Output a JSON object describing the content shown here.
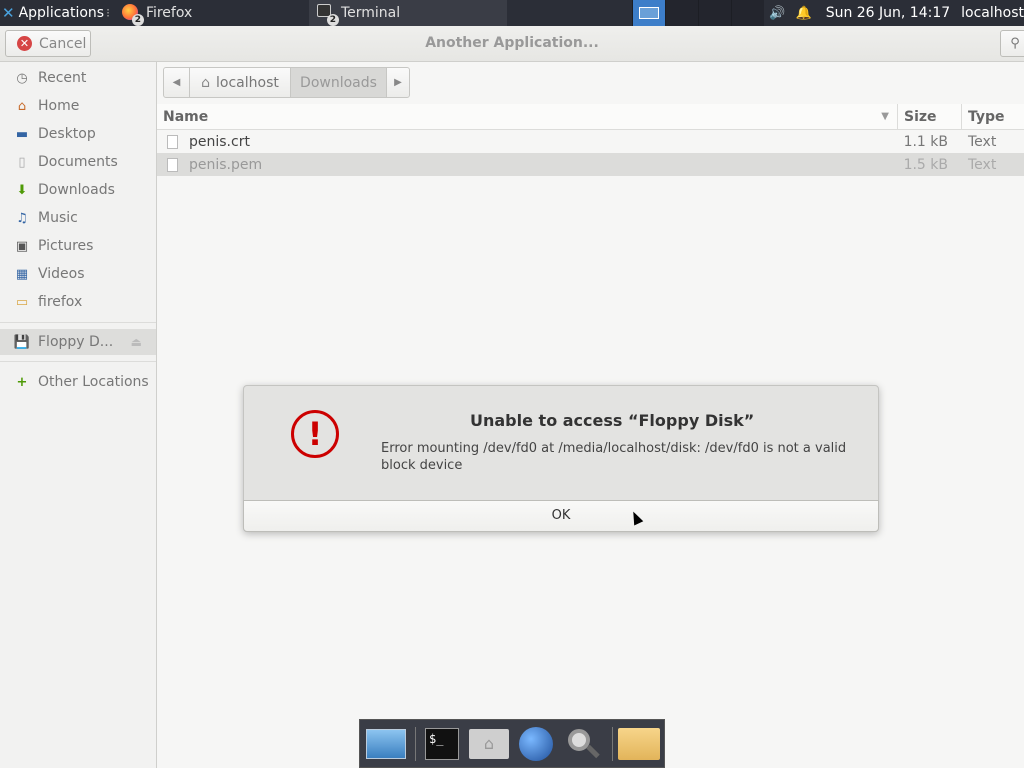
{
  "top_panel": {
    "applications_label": "Applications",
    "apps_more": "⁝",
    "tasks": [
      {
        "label": "Firefox",
        "badge": "2"
      },
      {
        "label": "Terminal",
        "badge": "2"
      }
    ],
    "volume_icon": "🔊",
    "bell_icon": "🔔",
    "clock": "Sun 26 Jun, 14:17",
    "user": "localhost"
  },
  "headerbar": {
    "cancel_label": "Cancel",
    "cancel_icon": "✕",
    "title": "Another Application...",
    "search_icon": "⚲"
  },
  "sidebar": {
    "places": [
      {
        "label": "Recent",
        "icon": "◷"
      },
      {
        "label": "Home",
        "icon": "⌂"
      },
      {
        "label": "Desktop",
        "icon": "▬"
      },
      {
        "label": "Documents",
        "icon": "▯"
      },
      {
        "label": "Downloads",
        "icon": "⬇"
      },
      {
        "label": "Music",
        "icon": "♫"
      },
      {
        "label": "Pictures",
        "icon": "▣"
      },
      {
        "label": "Videos",
        "icon": "▦"
      },
      {
        "label": "firefox",
        "icon": "▭"
      }
    ],
    "device": {
      "label": "Floppy D...",
      "icon": "💾",
      "eject": "⏏"
    },
    "other": {
      "label": "Other Locations",
      "icon": "+"
    }
  },
  "pathbar": {
    "back": "◀",
    "home_label": "localhost",
    "home_icon": "⌂",
    "current": "Downloads",
    "forward": "▶"
  },
  "filelist": {
    "columns": {
      "name": "Name",
      "size": "Size",
      "type": "Type",
      "sort_icon": "▼"
    },
    "rows": [
      {
        "name": "penis.crt",
        "size": "1.1 kB",
        "type": "Text"
      },
      {
        "name": "penis.pem",
        "size": "1.5 kB",
        "type": "Text"
      }
    ]
  },
  "dialog": {
    "icon": "!",
    "title": "Unable to access “Floppy Disk”",
    "message": "Error mounting /dev/fd0 at /media/localhost/disk: /dev/fd0 is not a valid block device",
    "ok_label": "OK"
  },
  "dock": {
    "terminal_glyph": "$_",
    "home_glyph": "⌂"
  }
}
